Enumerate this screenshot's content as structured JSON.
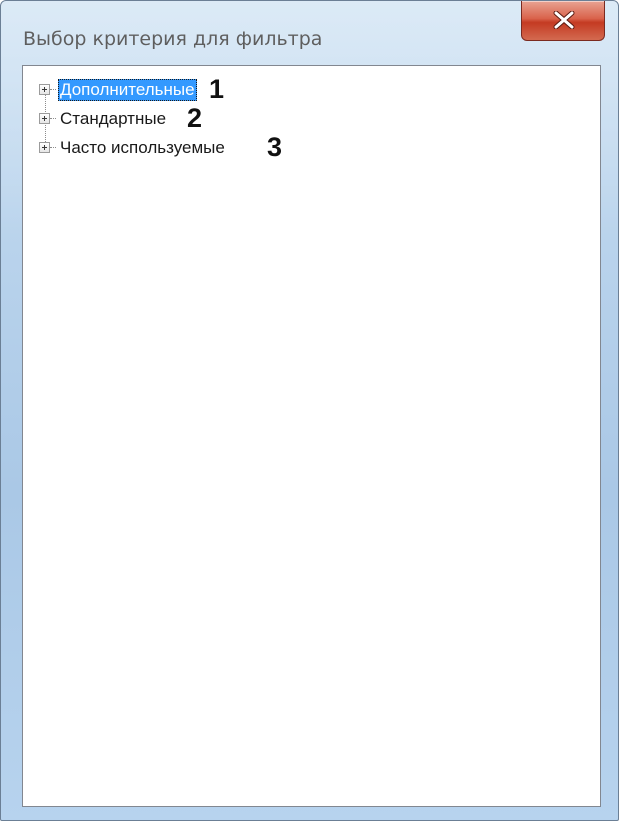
{
  "window": {
    "title": "Выбор критерия для фильтра",
    "close_icon": "close-icon"
  },
  "tree": {
    "items": [
      {
        "label": "Дополнительные",
        "marker": "1",
        "selected": true,
        "expander_icon": "plus-expander-icon"
      },
      {
        "label": "Стандартные",
        "marker": "2",
        "selected": false,
        "expander_icon": "plus-expander-icon"
      },
      {
        "label": "Часто используемые",
        "marker": "3",
        "selected": false,
        "expander_icon": "plus-expander-icon"
      }
    ]
  },
  "colors": {
    "selection": "#3399ff",
    "close_button": "#c43a22",
    "frame": "#b9d3ec"
  }
}
